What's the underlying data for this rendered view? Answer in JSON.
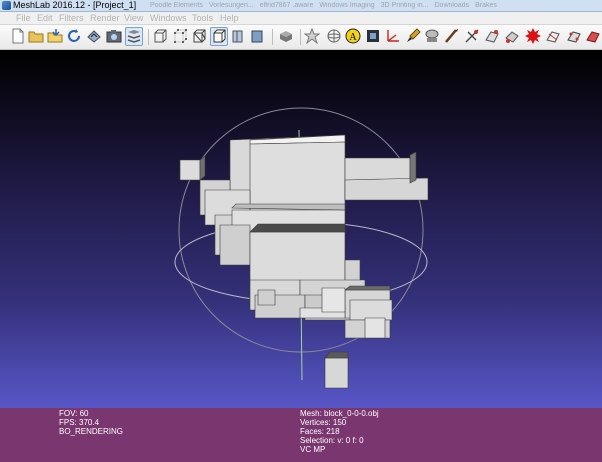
{
  "window": {
    "title": "MeshLab 2016.12 - [Project_1]",
    "background_tabs": [
      "Poodle Elements",
      "Vorlesungen...",
      "elfrid7867 .aware",
      "Windows Imaging",
      "3D Printing in...",
      "Downloads",
      "Brakes"
    ]
  },
  "menu": [
    "File",
    "Edit",
    "Filters",
    "Render",
    "View",
    "Windows",
    "Tools",
    "Help"
  ],
  "toolbar": {
    "icons": [
      "new-project-icon",
      "open-project-icon",
      "import-mesh-icon",
      "reload-icon",
      "save-snapshot-icon",
      "snapshot-camera-icon",
      "layer-dialog-icon",
      "bounding-box-icon",
      "points-icon",
      "wireframe-icon",
      "hidden-lines-icon",
      "flat-lines-icon",
      "flat-icon",
      "smooth-icon",
      "lighting-icon",
      "trackball-icon",
      "annotation-icon",
      "info-icon",
      "axis-icon",
      "paint-icon",
      "select-icon",
      "measure-icon",
      "align-icon",
      "georef-icon",
      "pick-icon"
    ],
    "active_icons": [
      "layer-dialog-icon",
      "wireframe-icon"
    ]
  },
  "info_panel": {
    "fov": "FOV: 60",
    "fps": "FPS:   370.4",
    "rendering": "BO_RENDERING",
    "mesh": "Mesh: block_0-0-0.obj",
    "vertices": "Vertices: 150",
    "faces": "Faces: 218",
    "selection": "Selection: v: 0 f: 0",
    "vc": "VC MP"
  },
  "colors": {
    "info_bg": "#7a366f",
    "viewport_top": "#000000",
    "viewport_bottom": "#5857c8",
    "mesh_face": "#d8d8d8"
  }
}
